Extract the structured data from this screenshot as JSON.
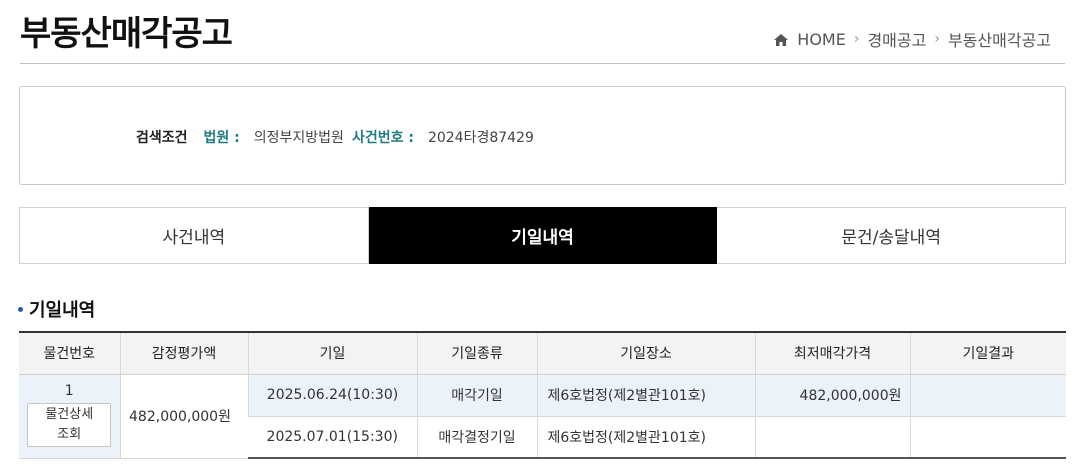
{
  "header": {
    "title": "부동산매각공고",
    "breadcrumb": {
      "home": "HOME",
      "level1": "경매공고",
      "level2": "부동산매각공고"
    }
  },
  "search": {
    "label": "검색조건",
    "court_label": "법원 :",
    "court_value": "의정부지방법원",
    "case_label": "사건번호 :",
    "case_value": "2024타경87429"
  },
  "tabs": [
    {
      "label": "사건내역",
      "active": false
    },
    {
      "label": "기일내역",
      "active": true
    },
    {
      "label": "문건/송달내역",
      "active": false
    }
  ],
  "section": {
    "title": "기일내역"
  },
  "table": {
    "headers": [
      "물건번호",
      "감정평가액",
      "기일",
      "기일종류",
      "기일장소",
      "최저매각가격",
      "기일결과"
    ],
    "item": {
      "no": "1",
      "detail_button": "물건상세\n조회",
      "appraisal": "482,000,000원"
    },
    "rows": [
      {
        "date": "2025.06.24(10:30)",
        "type": "매각기일",
        "place": "제6호법정(제2별관101호)",
        "min_price": "482,000,000원",
        "result": ""
      },
      {
        "date": "2025.07.01(15:30)",
        "type": "매각결정기일",
        "place": "제6호법정(제2별관101호)",
        "min_price": "",
        "result": ""
      }
    ]
  },
  "colors": {
    "accent_label": "#1f7c7e",
    "active_tab": "#000000",
    "row_highlight": "#ecf2fa"
  }
}
